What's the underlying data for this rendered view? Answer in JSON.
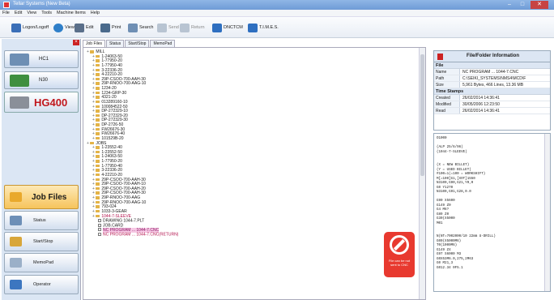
{
  "window": {
    "title": "Tellar Systems (New Beta)"
  },
  "menu": [
    "File",
    "Edit",
    "View",
    "Tools",
    "Machine Items",
    "Help"
  ],
  "toolbar": [
    {
      "label": "Logon/Logoff",
      "icon": "user-icon"
    },
    {
      "label": "View",
      "icon": "eye-icon"
    },
    {
      "label": "Edit",
      "icon": "scissors-icon"
    },
    {
      "label": "Print",
      "icon": "printer-icon"
    },
    {
      "label": "Search",
      "icon": "search-icon"
    },
    {
      "label": "Send",
      "icon": "send-icon"
    },
    {
      "label": "Return",
      "icon": "return-icon"
    },
    {
      "label": "DNCTCM",
      "icon": "network-icon"
    },
    {
      "label": "T.I.M.E.S.",
      "icon": "network-icon"
    }
  ],
  "machines": [
    {
      "label": "HC1",
      "color": "#6e8fb4"
    },
    {
      "label": "N30",
      "color": "#3f8f3f"
    },
    {
      "label": "HG400",
      "color": "#c0161c"
    }
  ],
  "nav": [
    {
      "label": "Job Files",
      "icon": "folder-icon"
    },
    {
      "label": "Status",
      "icon": "status-icon"
    },
    {
      "label": "Start/Stop",
      "icon": "startstop-icon"
    },
    {
      "label": "MemoPad",
      "icon": "memopad-icon"
    },
    {
      "label": "Operator",
      "icon": "operator-icon"
    }
  ],
  "tabs": [
    "Job Files",
    "Status",
    "Start/Stop",
    "MemoPad"
  ],
  "tree": [
    {
      "t": "MILL",
      "d": 0,
      "k": "f"
    },
    {
      "t": "1-24063-50",
      "d": 1,
      "k": "f"
    },
    {
      "t": "1-77950-20",
      "d": 1,
      "k": "f"
    },
    {
      "t": "1-77950-40",
      "d": 1,
      "k": "f"
    },
    {
      "t": "3-22336-20",
      "d": 1,
      "k": "f"
    },
    {
      "t": "4-22210-20",
      "d": 1,
      "k": "f"
    },
    {
      "t": "29P-CSOO-700-AAH-30",
      "d": 1,
      "k": "f"
    },
    {
      "t": "29P-RNOO-700-AAG-10",
      "d": 1,
      "k": "f"
    },
    {
      "t": "1234-20",
      "d": 1,
      "k": "f"
    },
    {
      "t": "1234-GRP-30",
      "d": 1,
      "k": "f"
    },
    {
      "t": "4321-20",
      "d": 1,
      "k": "f"
    },
    {
      "t": "013289160-10",
      "d": 1,
      "k": "f"
    },
    {
      "t": "100084522-50",
      "d": 1,
      "k": "f"
    },
    {
      "t": "DP-272329-10",
      "d": 1,
      "k": "f"
    },
    {
      "t": "DP-272329-20",
      "d": 1,
      "k": "f"
    },
    {
      "t": "DP-272329-30",
      "d": 1,
      "k": "f"
    },
    {
      "t": "DP-2726-50",
      "d": 1,
      "k": "f"
    },
    {
      "t": "FW26676-30",
      "d": 1,
      "k": "f"
    },
    {
      "t": "FW26676-40",
      "d": 1,
      "k": "f"
    },
    {
      "t": "101529B-20",
      "d": 1,
      "k": "f"
    },
    {
      "t": "JOBS",
      "d": 0,
      "k": "f"
    },
    {
      "t": "1-23552-40",
      "d": 1,
      "k": "f"
    },
    {
      "t": "1-23552-50",
      "d": 1,
      "k": "f"
    },
    {
      "t": "1-24063-50",
      "d": 1,
      "k": "f"
    },
    {
      "t": "1-77950-20",
      "d": 1,
      "k": "f"
    },
    {
      "t": "1-77950-40",
      "d": 1,
      "k": "f"
    },
    {
      "t": "3-22336-20",
      "d": 1,
      "k": "f"
    },
    {
      "t": "4-22210-20",
      "d": 1,
      "k": "f"
    },
    {
      "t": "29P-CSOO-700-AAH-30",
      "d": 1,
      "k": "f"
    },
    {
      "t": "29P-CSOO-700-AAH-10",
      "d": 1,
      "k": "f"
    },
    {
      "t": "29P-CSOO-700-AAH-20",
      "d": 1,
      "k": "f"
    },
    {
      "t": "29P-CSOO-700-AAH-30",
      "d": 1,
      "k": "f"
    },
    {
      "t": "29P-RNOO-700-AAG",
      "d": 1,
      "k": "f"
    },
    {
      "t": "29P-RNOO-700-AAG-10",
      "d": 1,
      "k": "f"
    },
    {
      "t": "793-024",
      "d": 1,
      "k": "f"
    },
    {
      "t": "1033-3-GEAR",
      "d": 1,
      "k": "f"
    },
    {
      "t": "1044-7-SLEEVE",
      "d": 1,
      "k": "f",
      "c": "red"
    },
    {
      "t": "DRAWING    1044-7.PLT",
      "d": 2,
      "k": "file"
    },
    {
      "t": "JOB.CARD",
      "d": 2,
      "k": "file"
    },
    {
      "t": "NC PROGRAM ... 1044-7.CNC",
      "d": 2,
      "k": "file",
      "c": "hl"
    },
    {
      "t": "NC PROGRAM ... 1044-7.CNC(RETURN)",
      "d": 2,
      "k": "file",
      "c": "red"
    }
  ],
  "no_entry": {
    "text": "File can be not sent to CNC"
  },
  "info": {
    "title": "File/Folder Information",
    "file_section": "File",
    "file": [
      {
        "k": "Name",
        "v": "NC PROGRAM ... 1044-7.CNC"
      },
      {
        "k": "Path",
        "v": "C:\\SEIKI_SYSTEMS\\NMS4\\MCD\\F"
      },
      {
        "k": "Size",
        "v": "5,961 Bytes, 466 Lines, 13.36 MB"
      }
    ],
    "time_section": "Time Stamps",
    "time": [
      {
        "k": "Created",
        "v": "26/02/2014 14:36:41"
      },
      {
        "k": "Modified",
        "v": "30/05/2006 12:23:50"
      },
      {
        "k": "Read",
        "v": "26/02/2014 14:36:41"
      }
    ]
  },
  "code": [
    "O1000",
    "",
    "(ALP 25/6/96)",
    "(1044-7-SLEEVE)",
    "",
    "",
    "(X = NEW BILLET)",
    "(Y = USED BILLET)",
    "#100=1(=100 = WORKSHIFT)",
    "M[=100]G1,[XOT]1550",
    "N3100,G90,G21,Y0,0",
    "G0 Y1270",
    "N3100,G91,G28,0.0",
    "",
    "G90 X5600",
    "G149 Z0",
    "G4 M6?",
    "G89 Z0",
    "G30(X5000",
    "M01",
    "",
    "",
    "N(NT=7002000/10 22mm U-DRILL)",
    "G00(X5000M6)",
    "T0(1000M6)",
    "G149 Z4",
    "G97 S6000 M3",
    "G0X53M6.0,275,2M63",
    "G0 M21,3",
    "G012.34 0F5.1"
  ]
}
